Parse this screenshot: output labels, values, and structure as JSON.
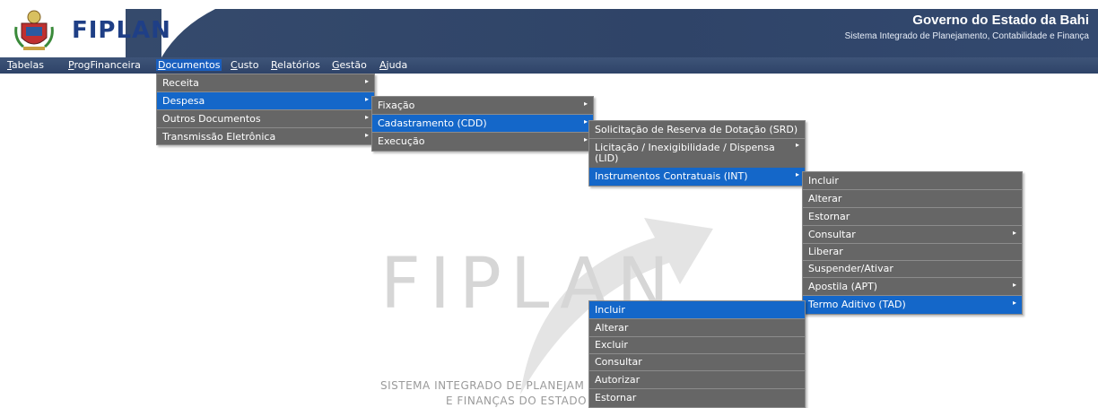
{
  "header": {
    "logo": "FIPLAN",
    "gov_title": "Governo do Estado da Bahi",
    "gov_subtitle": "Sistema Integrado de Planejamento, Contabilidade e Finança"
  },
  "menubar": {
    "items": [
      {
        "first": "T",
        "rest": "abelas"
      },
      {
        "first": "P",
        "rest": "rogFinanceira"
      },
      {
        "first": "D",
        "rest": "ocumentos"
      },
      {
        "first": "C",
        "rest": "usto"
      },
      {
        "first": "R",
        "rest": "elatórios"
      },
      {
        "first": "G",
        "rest": "estão"
      },
      {
        "first": "A",
        "rest": "juda"
      }
    ]
  },
  "menu_documentos": [
    "Receita",
    "Despesa",
    "Outros Documentos",
    "Transmissão Eletrônica"
  ],
  "menu_despesa": [
    "Fixação",
    "Cadastramento (CDD)",
    "Execução"
  ],
  "menu_cdd": [
    "Solicitação de Reserva de Dotação (SRD)",
    "Licitação / Inexigibilidade / Dispensa (LID)",
    "Instrumentos Contratuais (INT)"
  ],
  "menu_int": [
    "Incluir",
    "Alterar",
    "Estornar",
    "Consultar",
    "Liberar",
    "Suspender/Ativar",
    "Apostila (APT)",
    "Termo Aditivo (TAD)"
  ],
  "menu_tad": [
    "Incluir",
    "Alterar",
    "Excluir",
    "Consultar",
    "Autorizar",
    "Estornar"
  ],
  "watermark": {
    "logo": "FIPLAN",
    "line1": "SISTEMA INTEGRADO DE PLANEJAM",
    "line2": "E FINANÇAS DO ESTADO"
  },
  "colors": {
    "header_band": "#2f4468",
    "menu_bg": "#666666",
    "highlight": "#1467c9"
  },
  "icons": {
    "arrow": "▸"
  }
}
